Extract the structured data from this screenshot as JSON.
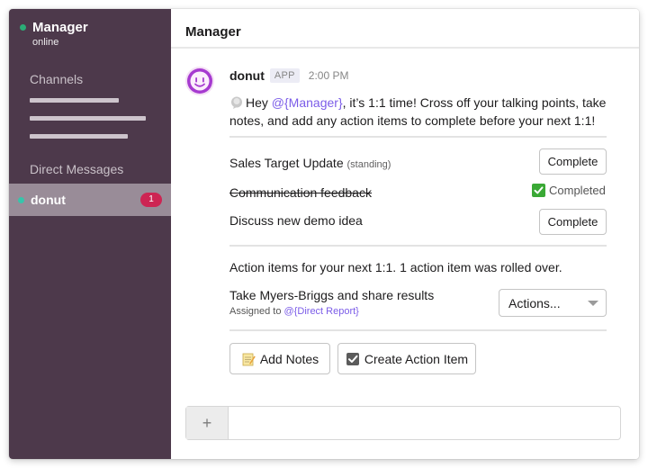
{
  "sidebar": {
    "team_name": "Manager",
    "team_status": "online",
    "channels_label": "Channels",
    "direct_messages_label": "Direct Messages",
    "dm_item": {
      "name": "donut",
      "badge": "1"
    },
    "colors": {
      "background": "#4d394b",
      "active_item": "#998c98",
      "presence": "#2bac76",
      "badge": "#cd2553"
    }
  },
  "channel": {
    "title": "Manager"
  },
  "message": {
    "sender": "donut",
    "app_tag": "APP",
    "time": "2:00 PM",
    "avatar_icon": "donut-face-icon",
    "text_icon": "speech-bubble-icon",
    "text_before": "Hey ",
    "mention": "@{Manager}",
    "text_after": ", it’s 1:1 time! Cross off your talking points, take notes, and add any action items to complete before your next 1:1!"
  },
  "talking_points": [
    {
      "title": "Sales Target Update",
      "note": "(standing)",
      "button_label": "Complete"
    },
    {
      "title": "Communication feedback",
      "status": "Completed"
    },
    {
      "title": "Discuss new demo idea",
      "button_label": "Complete"
    }
  ],
  "action_items": {
    "intro": "Action items for your next 1:1. 1 action item was rolled over.",
    "item_title": "Take Myers-Briggs and share results",
    "assigned_prefix": "Assigned to ",
    "assignee": "@{Direct Report}",
    "select_value": "Actions..."
  },
  "buttons": {
    "add_notes": "Add Notes",
    "create_action_item": "Create Action Item"
  },
  "composer": {
    "plus": "+",
    "placeholder": ""
  },
  "colors": {
    "mention": "#7b5ce8",
    "completed_check": "#3aa935"
  }
}
